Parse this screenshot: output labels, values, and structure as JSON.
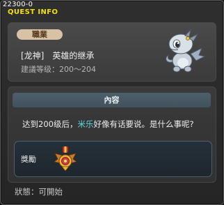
{
  "header": {
    "quest_id": "22300-0",
    "title": "QUEST INFO"
  },
  "job": {
    "badge_label": "職業",
    "name": "[龙神]　英雄的继承",
    "level_text": "建議等级：200～204",
    "portrait_icon": "dragon-mir-icon"
  },
  "content": {
    "header_label": "內容",
    "text_before": "达到200级后，",
    "npc_name": "米乐",
    "text_after": "好像有话要说。是什么事呢?",
    "npc_color": "#5fd9e6"
  },
  "reward": {
    "label": "獎勵",
    "item_icon": "medal-icon"
  },
  "status": {
    "text": "狀態：可開始"
  },
  "colors": {
    "title_yellow": "#f2e200",
    "badge_bg": "#d7c2a6",
    "content_header_bg": "#4d5f6b"
  }
}
